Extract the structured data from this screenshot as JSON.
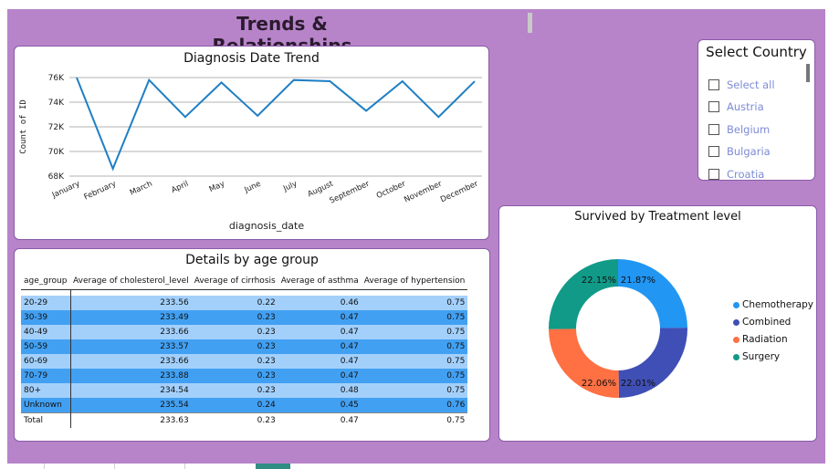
{
  "page": {
    "title": "Trends & Relationships"
  },
  "line_chart": {
    "title": "Diagnosis Date Trend",
    "xlabel": "diagnosis_date",
    "ylabel": "Count of ID"
  },
  "table": {
    "title": "Details by age group",
    "columns": [
      "age_group",
      "Average of cholesterol_level",
      "Average of cirrhosis",
      "Average of asthma",
      "Average of hypertension"
    ],
    "rows": [
      [
        "20-29",
        "233.56",
        "0.22",
        "0.46",
        "0.75"
      ],
      [
        "30-39",
        "233.49",
        "0.23",
        "0.47",
        "0.75"
      ],
      [
        "40-49",
        "233.66",
        "0.23",
        "0.47",
        "0.75"
      ],
      [
        "50-59",
        "233.57",
        "0.23",
        "0.47",
        "0.75"
      ],
      [
        "60-69",
        "233.66",
        "0.23",
        "0.47",
        "0.75"
      ],
      [
        "70-79",
        "233.88",
        "0.23",
        "0.47",
        "0.75"
      ],
      [
        "80+",
        "234.54",
        "0.23",
        "0.48",
        "0.75"
      ],
      [
        "Unknown",
        "235.54",
        "0.24",
        "0.45",
        "0.76"
      ]
    ],
    "total": [
      "Total",
      "233.63",
      "0.23",
      "0.47",
      "0.75"
    ]
  },
  "slicer": {
    "title": "Select Country",
    "items": [
      "Select all",
      "Austria",
      "Belgium",
      "Bulgaria",
      "Croatia"
    ]
  },
  "donut": {
    "title": "Survived by Treatment level"
  },
  "chart_data": [
    {
      "type": "line",
      "title": "Diagnosis Date Trend",
      "xlabel": "diagnosis_date",
      "ylabel": "Count of ID",
      "categories": [
        "January",
        "February",
        "March",
        "April",
        "May",
        "June",
        "July",
        "August",
        "September",
        "October",
        "November",
        "December"
      ],
      "values": [
        76000,
        68600,
        75800,
        72800,
        75600,
        72900,
        75800,
        75700,
        73300,
        75700,
        72800,
        75700
      ],
      "y_ticks": [
        "68K",
        "70K",
        "72K",
        "74K",
        "76K"
      ],
      "ylim": [
        68000,
        76000
      ],
      "grid": true,
      "color": "#1f7fc4"
    },
    {
      "type": "pie",
      "title": "Survived by Treatment level",
      "labels": [
        "Chemotherapy",
        "Combined",
        "Radiation",
        "Surgery"
      ],
      "values": [
        21.87,
        22.01,
        22.06,
        22.15
      ],
      "value_labels": [
        "21.87%",
        "22.01%",
        "22.06%",
        "22.15%"
      ],
      "colors": [
        "#2196f3",
        "#3f4fb5",
        "#ff7043",
        "#119a88"
      ],
      "legend": "right"
    }
  ]
}
